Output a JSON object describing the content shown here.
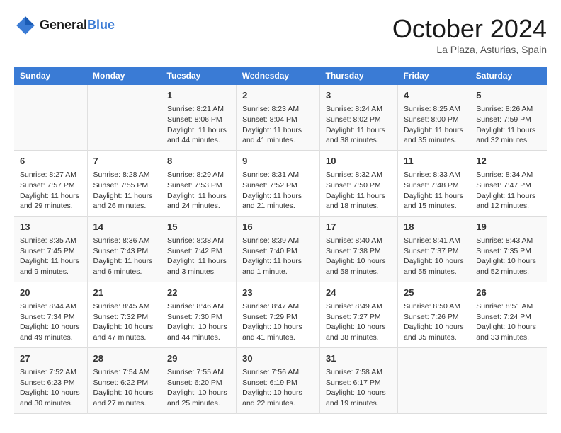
{
  "logo": {
    "line1": "General",
    "line2": "Blue"
  },
  "title": "October 2024",
  "location": "La Plaza, Asturias, Spain",
  "headers": [
    "Sunday",
    "Monday",
    "Tuesday",
    "Wednesday",
    "Thursday",
    "Friday",
    "Saturday"
  ],
  "weeks": [
    [
      {
        "day": "",
        "content": ""
      },
      {
        "day": "",
        "content": ""
      },
      {
        "day": "1",
        "content": "Sunrise: 8:21 AM\nSunset: 8:06 PM\nDaylight: 11 hours and 44 minutes."
      },
      {
        "day": "2",
        "content": "Sunrise: 8:23 AM\nSunset: 8:04 PM\nDaylight: 11 hours and 41 minutes."
      },
      {
        "day": "3",
        "content": "Sunrise: 8:24 AM\nSunset: 8:02 PM\nDaylight: 11 hours and 38 minutes."
      },
      {
        "day": "4",
        "content": "Sunrise: 8:25 AM\nSunset: 8:00 PM\nDaylight: 11 hours and 35 minutes."
      },
      {
        "day": "5",
        "content": "Sunrise: 8:26 AM\nSunset: 7:59 PM\nDaylight: 11 hours and 32 minutes."
      }
    ],
    [
      {
        "day": "6",
        "content": "Sunrise: 8:27 AM\nSunset: 7:57 PM\nDaylight: 11 hours and 29 minutes."
      },
      {
        "day": "7",
        "content": "Sunrise: 8:28 AM\nSunset: 7:55 PM\nDaylight: 11 hours and 26 minutes."
      },
      {
        "day": "8",
        "content": "Sunrise: 8:29 AM\nSunset: 7:53 PM\nDaylight: 11 hours and 24 minutes."
      },
      {
        "day": "9",
        "content": "Sunrise: 8:31 AM\nSunset: 7:52 PM\nDaylight: 11 hours and 21 minutes."
      },
      {
        "day": "10",
        "content": "Sunrise: 8:32 AM\nSunset: 7:50 PM\nDaylight: 11 hours and 18 minutes."
      },
      {
        "day": "11",
        "content": "Sunrise: 8:33 AM\nSunset: 7:48 PM\nDaylight: 11 hours and 15 minutes."
      },
      {
        "day": "12",
        "content": "Sunrise: 8:34 AM\nSunset: 7:47 PM\nDaylight: 11 hours and 12 minutes."
      }
    ],
    [
      {
        "day": "13",
        "content": "Sunrise: 8:35 AM\nSunset: 7:45 PM\nDaylight: 11 hours and 9 minutes."
      },
      {
        "day": "14",
        "content": "Sunrise: 8:36 AM\nSunset: 7:43 PM\nDaylight: 11 hours and 6 minutes."
      },
      {
        "day": "15",
        "content": "Sunrise: 8:38 AM\nSunset: 7:42 PM\nDaylight: 11 hours and 3 minutes."
      },
      {
        "day": "16",
        "content": "Sunrise: 8:39 AM\nSunset: 7:40 PM\nDaylight: 11 hours and 1 minute."
      },
      {
        "day": "17",
        "content": "Sunrise: 8:40 AM\nSunset: 7:38 PM\nDaylight: 10 hours and 58 minutes."
      },
      {
        "day": "18",
        "content": "Sunrise: 8:41 AM\nSunset: 7:37 PM\nDaylight: 10 hours and 55 minutes."
      },
      {
        "day": "19",
        "content": "Sunrise: 8:43 AM\nSunset: 7:35 PM\nDaylight: 10 hours and 52 minutes."
      }
    ],
    [
      {
        "day": "20",
        "content": "Sunrise: 8:44 AM\nSunset: 7:34 PM\nDaylight: 10 hours and 49 minutes."
      },
      {
        "day": "21",
        "content": "Sunrise: 8:45 AM\nSunset: 7:32 PM\nDaylight: 10 hours and 47 minutes."
      },
      {
        "day": "22",
        "content": "Sunrise: 8:46 AM\nSunset: 7:30 PM\nDaylight: 10 hours and 44 minutes."
      },
      {
        "day": "23",
        "content": "Sunrise: 8:47 AM\nSunset: 7:29 PM\nDaylight: 10 hours and 41 minutes."
      },
      {
        "day": "24",
        "content": "Sunrise: 8:49 AM\nSunset: 7:27 PM\nDaylight: 10 hours and 38 minutes."
      },
      {
        "day": "25",
        "content": "Sunrise: 8:50 AM\nSunset: 7:26 PM\nDaylight: 10 hours and 35 minutes."
      },
      {
        "day": "26",
        "content": "Sunrise: 8:51 AM\nSunset: 7:24 PM\nDaylight: 10 hours and 33 minutes."
      }
    ],
    [
      {
        "day": "27",
        "content": "Sunrise: 7:52 AM\nSunset: 6:23 PM\nDaylight: 10 hours and 30 minutes."
      },
      {
        "day": "28",
        "content": "Sunrise: 7:54 AM\nSunset: 6:22 PM\nDaylight: 10 hours and 27 minutes."
      },
      {
        "day": "29",
        "content": "Sunrise: 7:55 AM\nSunset: 6:20 PM\nDaylight: 10 hours and 25 minutes."
      },
      {
        "day": "30",
        "content": "Sunrise: 7:56 AM\nSunset: 6:19 PM\nDaylight: 10 hours and 22 minutes."
      },
      {
        "day": "31",
        "content": "Sunrise: 7:58 AM\nSunset: 6:17 PM\nDaylight: 10 hours and 19 minutes."
      },
      {
        "day": "",
        "content": ""
      },
      {
        "day": "",
        "content": ""
      }
    ]
  ]
}
